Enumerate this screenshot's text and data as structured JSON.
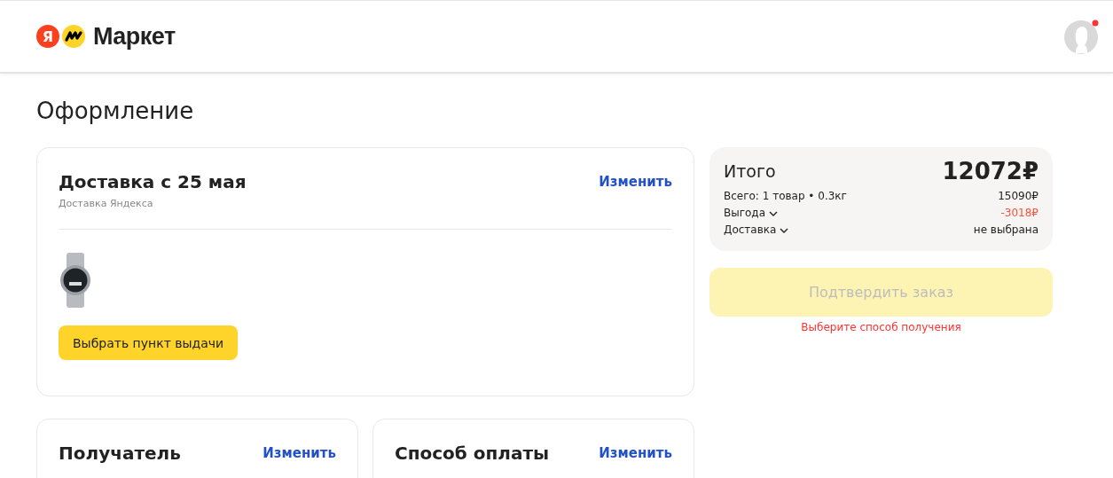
{
  "header": {
    "logo_letter": "Я",
    "logo_text": "Маркет",
    "avatar": {
      "notification": true
    }
  },
  "page_title": "Оформление",
  "delivery": {
    "title": "Доставка с 25 мая",
    "subtitle": "Доставка Яндекса",
    "change_link": "Изменить",
    "pickup_button": "Выбрать пункт выдачи"
  },
  "sections": [
    {
      "title": "Получатель",
      "change_link": "Изменить"
    },
    {
      "title": "Способ оплаты",
      "change_link": "Изменить"
    }
  ],
  "summary": {
    "title": "Итого",
    "total": "12072₽",
    "rows": [
      {
        "label": "Всего: 1 товар • 0.3кг",
        "value": "15090₽",
        "kind": "normal",
        "expandable": false
      },
      {
        "label": "Выгода",
        "value": "-3018₽",
        "kind": "discount",
        "expandable": true
      },
      {
        "label": "Доставка",
        "value": "не выбрана",
        "kind": "normal",
        "expandable": true
      }
    ]
  },
  "confirm_button": {
    "label": "Подтвердить заказ",
    "disabled": true
  },
  "error": "Выберите способ получения"
}
